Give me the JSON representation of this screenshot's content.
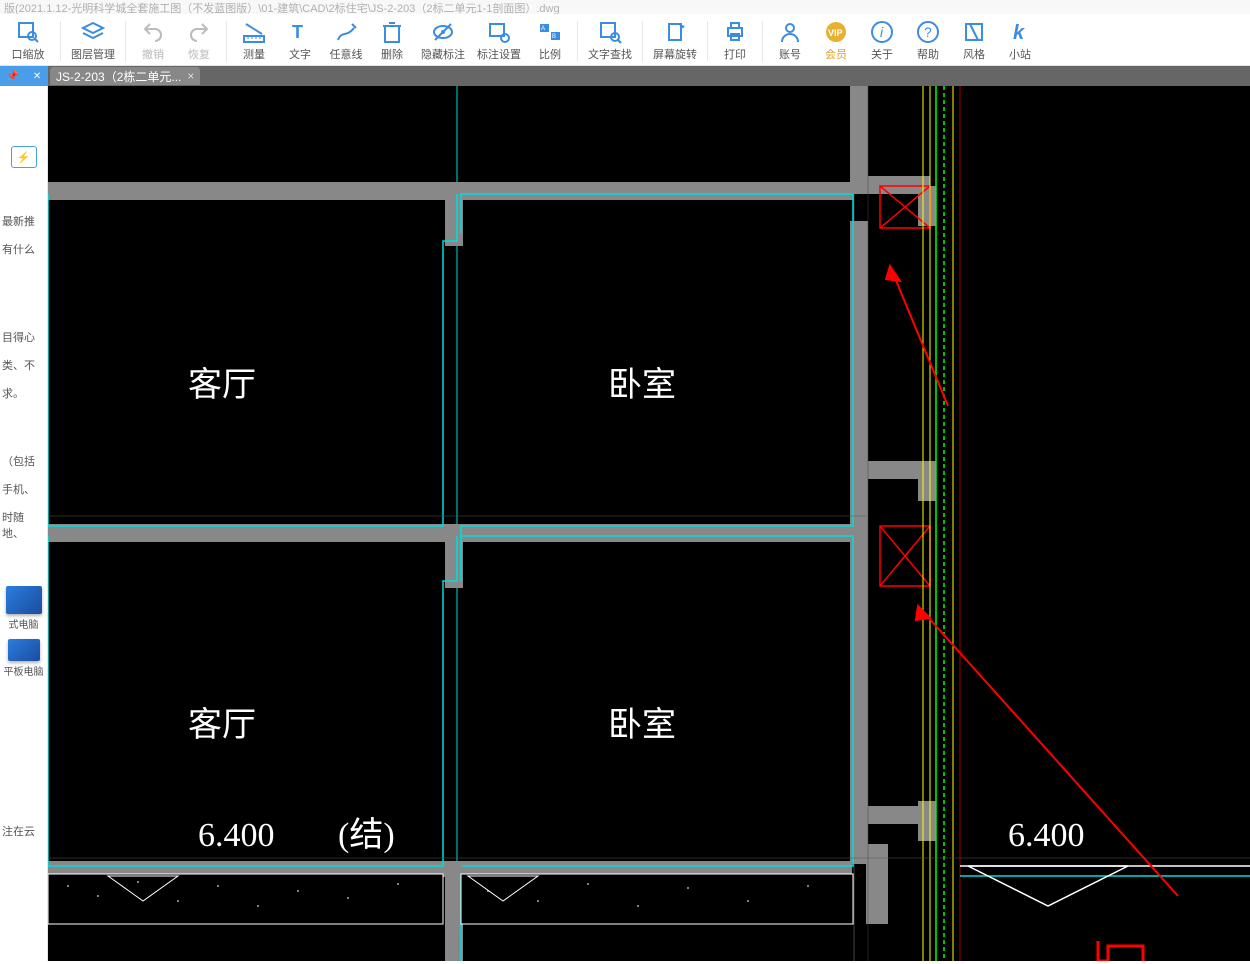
{
  "window": {
    "title": "版(2021.1.12-光明科学城全套施工图（不发蓝图版）\\01-建筑\\CAD\\2标住宅\\JS-2-203（2标二单元1-1剖面图）.dwg"
  },
  "toolbar": {
    "zoomwin": "口缩放",
    "layers": "图层管理",
    "undo": "撤销",
    "redo": "恢复",
    "measure": "测量",
    "text": "文字",
    "freeline": "任意线",
    "delete": "删除",
    "hidenote": "隐藏标注",
    "noteset": "标注设置",
    "scale": "比例",
    "textfind": "文字查找",
    "rotate": "屏幕旋转",
    "print": "打印",
    "account": "账号",
    "vip": "会员",
    "about": "关于",
    "help": "帮助",
    "style": "风格",
    "site": "小站"
  },
  "tabs": {
    "file1": "JS-2-203（2栋二单元..."
  },
  "sidebar": {
    "txt1": "最新推",
    "txt2": "有什么",
    "txt3": "目得心",
    "txt4": "类、不",
    "txt5": "求。",
    "txt6": "（包括",
    "txt7": "手机、",
    "txt8": "时随地、",
    "dev1": "式电脑",
    "dev2": "平板电脑",
    "cloud": "注在云"
  },
  "drawing": {
    "room_living": "客厅",
    "room_bed": "卧室",
    "dim_value": "6.400",
    "dim_note": "(结)"
  }
}
